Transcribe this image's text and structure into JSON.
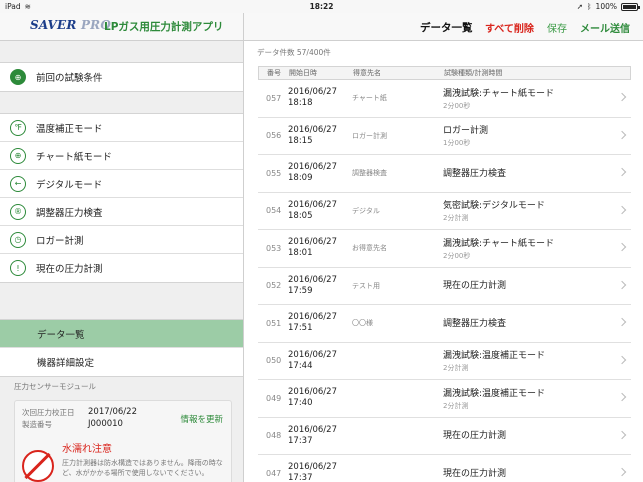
{
  "status": {
    "device": "iPad",
    "time": "18:22",
    "battery": "100%"
  },
  "leftnav": {
    "logo_main": "SAVER",
    "logo_pro": "PRO",
    "title": "LPガス用圧力計測アプリ"
  },
  "rightnav": {
    "title": "データ一覧",
    "delete_all": "すべて削除",
    "save": "保存",
    "send_mail": "メール送信"
  },
  "menu": {
    "prev": {
      "label": "前回の試験条件",
      "icon": "⊕"
    },
    "items": [
      {
        "label": "温度補正モード",
        "icon": "℉"
      },
      {
        "label": "チャート紙モード",
        "icon": "⊕"
      },
      {
        "label": "デジタルモード",
        "icon": "←"
      },
      {
        "label": "調整器圧力検査",
        "icon": "®"
      },
      {
        "label": "ロガー計測",
        "icon": "◷"
      },
      {
        "label": "現在の圧力計測",
        "icon": "!"
      }
    ],
    "bottom": [
      {
        "label": "データ一覧"
      },
      {
        "label": "機器詳細設定"
      }
    ]
  },
  "sensor": {
    "heading": "圧力センサーモジュール",
    "calib_label": "次回圧力校正日",
    "calib_value": "2017/06/22",
    "serial_label": "製造番号",
    "serial_value": "J000010",
    "update": "情報を更新",
    "warn_title": "水濡れ注意",
    "warn_text": "圧力計測器は防水構造ではありません。降雨の時など、水がかかる場所で使用しないでください。"
  },
  "list": {
    "count": "データ件数 57/400件",
    "headers": {
      "no": "番号",
      "date": "開始日時",
      "name": "得意先名",
      "type": "試験種類/計測時間"
    },
    "rows": [
      {
        "no": "057",
        "date": "2016/06/27",
        "time": "18:18",
        "name": "チャート紙",
        "type": "漏洩試験:チャート紙モード",
        "dur": "2分00秒"
      },
      {
        "no": "056",
        "date": "2016/06/27",
        "time": "18:15",
        "name": "ロガー計測",
        "type": "ロガー計測",
        "dur": "1分00秒"
      },
      {
        "no": "055",
        "date": "2016/06/27",
        "time": "18:09",
        "name": "調整器検査",
        "type": "調整器圧力検査",
        "dur": ""
      },
      {
        "no": "054",
        "date": "2016/06/27",
        "time": "18:05",
        "name": "デジタル",
        "type": "気密試験:デジタルモード",
        "dur": "2分計測"
      },
      {
        "no": "053",
        "date": "2016/06/27",
        "time": "18:01",
        "name": "お得意先名",
        "type": "漏洩試験:チャート紙モード",
        "dur": "2分00秒"
      },
      {
        "no": "052",
        "date": "2016/06/27",
        "time": "17:59",
        "name": "テスト用",
        "type": "現在の圧力計測",
        "dur": ""
      },
      {
        "no": "051",
        "date": "2016/06/27",
        "time": "17:51",
        "name": "〇〇様",
        "type": "調整器圧力検査",
        "dur": ""
      },
      {
        "no": "050",
        "date": "2016/06/27",
        "time": "17:44",
        "name": "",
        "type": "漏洩試験:温度補正モード",
        "dur": "2分計測"
      },
      {
        "no": "049",
        "date": "2016/06/27",
        "time": "17:40",
        "name": "",
        "type": "漏洩試験:温度補正モード",
        "dur": "2分計測"
      },
      {
        "no": "048",
        "date": "2016/06/27",
        "time": "17:37",
        "name": "",
        "type": "現在の圧力計測",
        "dur": ""
      },
      {
        "no": "047",
        "date": "2016/06/27",
        "time": "17:37",
        "name": "",
        "type": "現在の圧力計測",
        "dur": ""
      }
    ]
  }
}
